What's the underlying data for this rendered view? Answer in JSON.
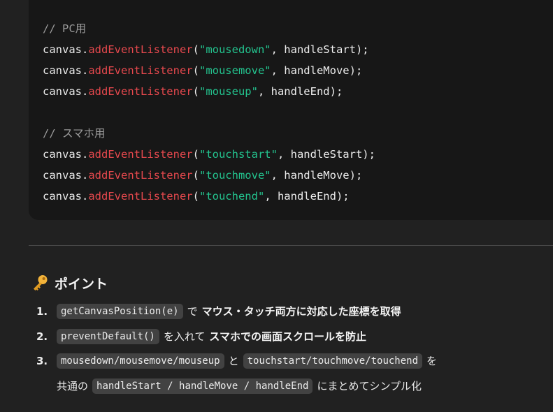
{
  "code": {
    "lines": [
      {
        "tokens": [
          {
            "cls": "comment",
            "text": "// PC用"
          }
        ]
      },
      {
        "tokens": [
          {
            "cls": "plain",
            "text": "canvas."
          },
          {
            "cls": "fn",
            "text": "addEventListener"
          },
          {
            "cls": "plain",
            "text": "("
          },
          {
            "cls": "str",
            "text": "\"mousedown\""
          },
          {
            "cls": "plain",
            "text": ", handleStart);"
          }
        ]
      },
      {
        "tokens": [
          {
            "cls": "plain",
            "text": "canvas."
          },
          {
            "cls": "fn",
            "text": "addEventListener"
          },
          {
            "cls": "plain",
            "text": "("
          },
          {
            "cls": "str",
            "text": "\"mousemove\""
          },
          {
            "cls": "plain",
            "text": ", handleMove);"
          }
        ]
      },
      {
        "tokens": [
          {
            "cls": "plain",
            "text": "canvas."
          },
          {
            "cls": "fn",
            "text": "addEventListener"
          },
          {
            "cls": "plain",
            "text": "("
          },
          {
            "cls": "str",
            "text": "\"mouseup\""
          },
          {
            "cls": "plain",
            "text": ", handleEnd);"
          }
        ]
      },
      {
        "tokens": []
      },
      {
        "tokens": [
          {
            "cls": "comment",
            "text": "// スマホ用"
          }
        ]
      },
      {
        "tokens": [
          {
            "cls": "plain",
            "text": "canvas."
          },
          {
            "cls": "fn",
            "text": "addEventListener"
          },
          {
            "cls": "plain",
            "text": "("
          },
          {
            "cls": "str",
            "text": "\"touchstart\""
          },
          {
            "cls": "plain",
            "text": ", handleStart);"
          }
        ]
      },
      {
        "tokens": [
          {
            "cls": "plain",
            "text": "canvas."
          },
          {
            "cls": "fn",
            "text": "addEventListener"
          },
          {
            "cls": "plain",
            "text": "("
          },
          {
            "cls": "str",
            "text": "\"touchmove\""
          },
          {
            "cls": "plain",
            "text": ", handleMove);"
          }
        ]
      },
      {
        "tokens": [
          {
            "cls": "plain",
            "text": "canvas."
          },
          {
            "cls": "fn",
            "text": "addEventListener"
          },
          {
            "cls": "plain",
            "text": "("
          },
          {
            "cls": "str",
            "text": "\"touchend\""
          },
          {
            "cls": "plain",
            "text": ", handleEnd);"
          }
        ]
      }
    ]
  },
  "points": {
    "icon": "key-icon",
    "heading": "ポイント",
    "items": [
      {
        "number": "1.",
        "code": "getCanvasPosition(e)",
        "text": "で",
        "bold": "マウス・タッチ両方に対応した座標を取得"
      },
      {
        "number": "2.",
        "code": "preventDefault()",
        "text": "を入れて",
        "bold": "スマホでの画面スクロールを防止"
      },
      {
        "number": "3.",
        "code": "mousedown/mousemove/mouseup",
        "text": "と",
        "code2": "touchstart/touchmove/touchend",
        "text2": "を",
        "line2_text": "共通の",
        "line2_code": "handleStart / handleMove / handleEnd",
        "line2_text2": "にまとめてシンプル化"
      }
    ]
  },
  "colors": {
    "page_bg": "#212121",
    "code_bg": "#171717",
    "function": "#e5484d",
    "string": "#23c38e",
    "comment": "#9a9a9a",
    "inline_code_bg": "#424242"
  }
}
